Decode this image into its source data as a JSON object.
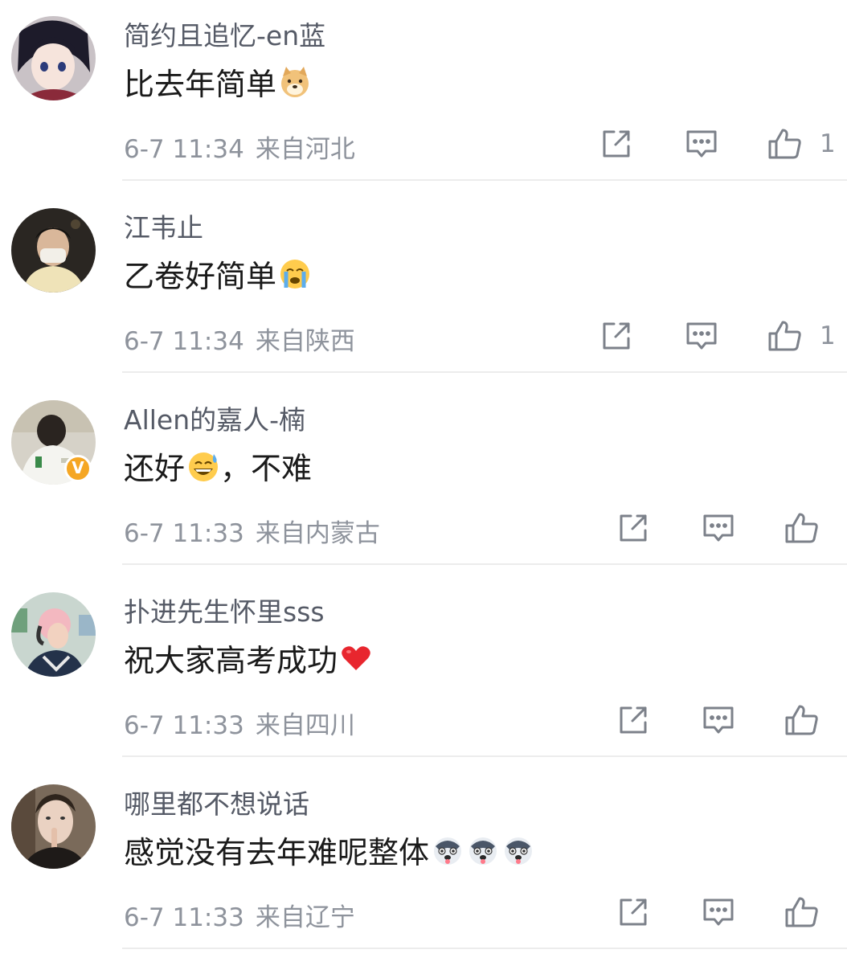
{
  "comments": [
    {
      "username": "简约且追忆-en蓝",
      "text": "比去年简单",
      "emoji": "doge-icon",
      "time": "6-7 11:34",
      "location": "来自河北",
      "likes": "1"
    },
    {
      "username": "江韦止",
      "text": "乙卷好简单",
      "emoji": "crying-face-icon",
      "time": "6-7 11:34",
      "location": "来自陕西",
      "likes": "1"
    },
    {
      "username": "Allen的嘉人-楠",
      "text": "还好",
      "text_after": "，不难",
      "emoji": "sweat-smile-icon",
      "time": "6-7 11:33",
      "location": "来自内蒙古",
      "likes": "",
      "verified_badge": "V"
    },
    {
      "username": "扑进先生怀里sss",
      "text": "祝大家高考成功",
      "emoji": "red-heart-icon",
      "time": "6-7 11:33",
      "location": "来自四川",
      "likes": ""
    },
    {
      "username": "哪里都不想说话",
      "text": "感觉没有去年难呢整体",
      "emoji": "husky-icon",
      "emoji_count": 3,
      "time": "6-7 11:33",
      "location": "来自辽宁",
      "likes": ""
    }
  ],
  "colors": {
    "username": "#555a66",
    "text": "#1a1a1a",
    "meta": "#8e939c",
    "icon": "#7c818a",
    "divider": "#ececec",
    "verified": "#f5a623"
  }
}
